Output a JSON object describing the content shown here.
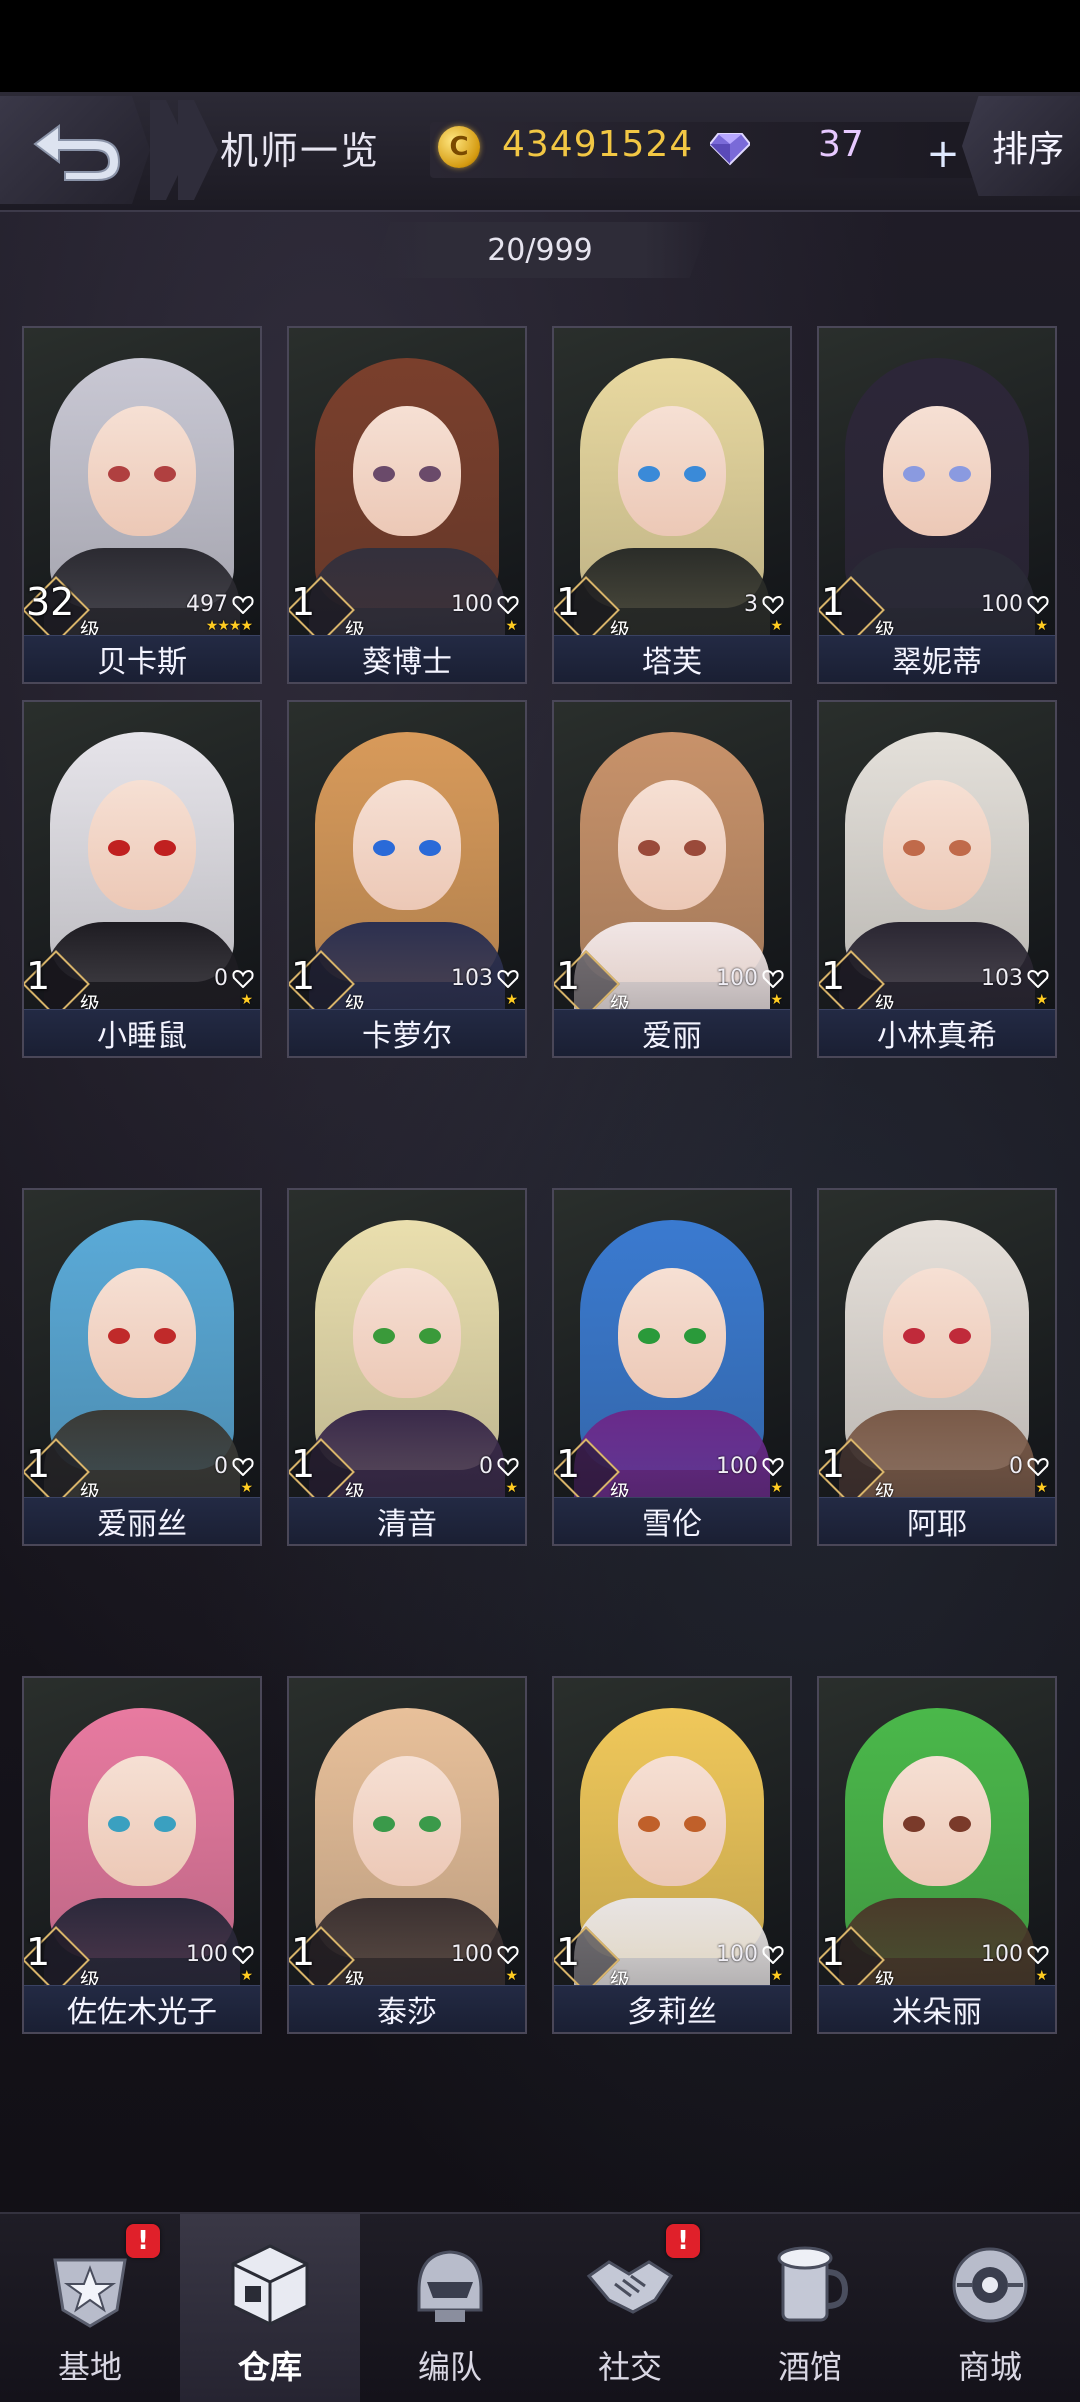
{
  "header": {
    "title": "机师一览",
    "coins": "43491524",
    "gems": "37",
    "plus": "+",
    "sort_label": "排序"
  },
  "count": "20/999",
  "level_unit": "级",
  "pilots": [
    {
      "name": "贝卡斯",
      "level": "32",
      "stat": "497",
      "stars": "★★★★",
      "hair": "#c9c8d4",
      "eyes": "#b04040",
      "outfit": "#2b2a31"
    },
    {
      "name": "葵博士",
      "level": "1",
      "stat": "100",
      "stars": "★",
      "hair": "#7a3f2c",
      "eyes": "#6a4a6a",
      "outfit": "#33303c"
    },
    {
      "name": "塔芙",
      "level": "1",
      "stat": "3",
      "stars": "★",
      "hair": "#e9d9a0",
      "eyes": "#3a8ad8",
      "outfit": "#2a2c28"
    },
    {
      "name": "翠妮蒂",
      "level": "1",
      "stat": "100",
      "stars": "★",
      "hair": "#2c2638",
      "eyes": "#8a9ae0",
      "outfit": "#2a2a36"
    },
    {
      "name": "小睡鼠",
      "level": "1",
      "stat": "0",
      "stars": "★",
      "hair": "#e6e4ea",
      "eyes": "#c02020",
      "outfit": "#1e1c22"
    },
    {
      "name": "卡萝尔",
      "level": "1",
      "stat": "103",
      "stars": "★",
      "hair": "#d89a5a",
      "eyes": "#2a6ad8",
      "outfit": "#2c3050"
    },
    {
      "name": "爱丽",
      "level": "1",
      "stat": "100",
      "stars": "★",
      "hair": "#c8926a",
      "eyes": "#9a4a3a",
      "outfit": "#f1e6e6"
    },
    {
      "name": "小林真希",
      "level": "1",
      "stat": "103",
      "stars": "★",
      "hair": "#e4e0da",
      "eyes": "#c06a4a",
      "outfit": "#2a2632"
    },
    {
      "name": "爱丽丝",
      "level": "1",
      "stat": "0",
      "stars": "★",
      "hair": "#5aaad8",
      "eyes": "#c02a2a",
      "outfit": "#3a3a36"
    },
    {
      "name": "清音",
      "level": "1",
      "stat": "0",
      "stars": "★",
      "hair": "#eadfae",
      "eyes": "#3a9a3a",
      "outfit": "#3a2a4a"
    },
    {
      "name": "雪伦",
      "level": "1",
      "stat": "100",
      "stars": "★",
      "hair": "#3a7ad0",
      "eyes": "#2a9a3a",
      "outfit": "#6a2a8a"
    },
    {
      "name": "阿耶",
      "level": "1",
      "stat": "0",
      "stars": "★",
      "hair": "#e6e0da",
      "eyes": "#c02a3a",
      "outfit": "#7a5a48"
    },
    {
      "name": "佐佐木光子",
      "level": "1",
      "stat": "100",
      "stars": "★",
      "hair": "#e87aa0",
      "eyes": "#3aa0c0",
      "outfit": "#2a283a"
    },
    {
      "name": "泰莎",
      "level": "1",
      "stat": "100",
      "stars": "★",
      "hair": "#e8c09a",
      "eyes": "#3a9a4a",
      "outfit": "#3a3030"
    },
    {
      "name": "多莉丝",
      "level": "1",
      "stat": "100",
      "stars": "★",
      "hair": "#f0c85a",
      "eyes": "#c0602a",
      "outfit": "#e8e4e4"
    },
    {
      "name": "米朵丽",
      "level": "1",
      "stat": "100",
      "stars": "★",
      "hair": "#4ab84a",
      "eyes": "#7a3a2a",
      "outfit": "#4a3a2a"
    }
  ],
  "nav": [
    {
      "label": "基地",
      "badge": "!"
    },
    {
      "label": "仓库",
      "badge": ""
    },
    {
      "label": "编队",
      "badge": ""
    },
    {
      "label": "社交",
      "badge": "!"
    },
    {
      "label": "酒馆",
      "badge": ""
    },
    {
      "label": "商城",
      "badge": ""
    }
  ],
  "colors": {
    "accent_gold": "#f2c744",
    "gem_purple": "#e7c9ff",
    "name_bar": "#1f2540",
    "badge_red": "#e0202a"
  }
}
